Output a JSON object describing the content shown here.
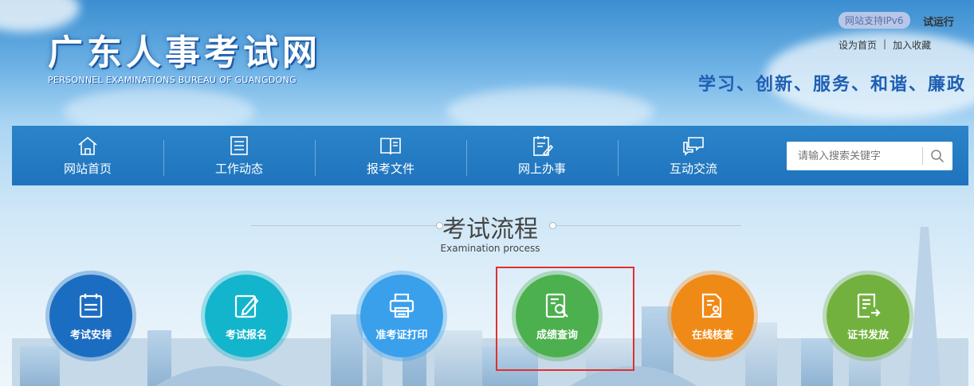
{
  "header": {
    "logo_cn": "广东人事考试网",
    "logo_en": "PERSONNEL EXAMINATIONS BUREAU OF GUANGDONG",
    "ipv6": "网站支持IPv6",
    "trial": "试运行",
    "set_home": "设为首页",
    "separator": "|",
    "add_favorite": "加入收藏",
    "slogan": "学习、创新、服务、和谐、廉政"
  },
  "nav": {
    "items": [
      {
        "label": "网站首页",
        "icon": "home-icon"
      },
      {
        "label": "工作动态",
        "icon": "news-icon"
      },
      {
        "label": "报考文件",
        "icon": "book-icon"
      },
      {
        "label": "网上办事",
        "icon": "clipboard-icon"
      },
      {
        "label": "互动交流",
        "icon": "chat-icon"
      }
    ],
    "search_placeholder": "请输入搜索关键字"
  },
  "process": {
    "title": "考试流程",
    "subtitle": "Examination process",
    "steps": [
      {
        "label": "考试安排",
        "color": "#1b6dc1"
      },
      {
        "label": "考试报名",
        "color": "#12b5cc"
      },
      {
        "label": "准考证打印",
        "color": "#3aa0ec"
      },
      {
        "label": "成绩查询",
        "color": "#4bb04d"
      },
      {
        "label": "在线核查",
        "color": "#f08a16"
      },
      {
        "label": "证书发放",
        "color": "#72b13e"
      }
    ]
  },
  "colors": {
    "nav_bg": "#2280c6",
    "slogan": "#1f5fb3",
    "highlight": "#e03030"
  }
}
